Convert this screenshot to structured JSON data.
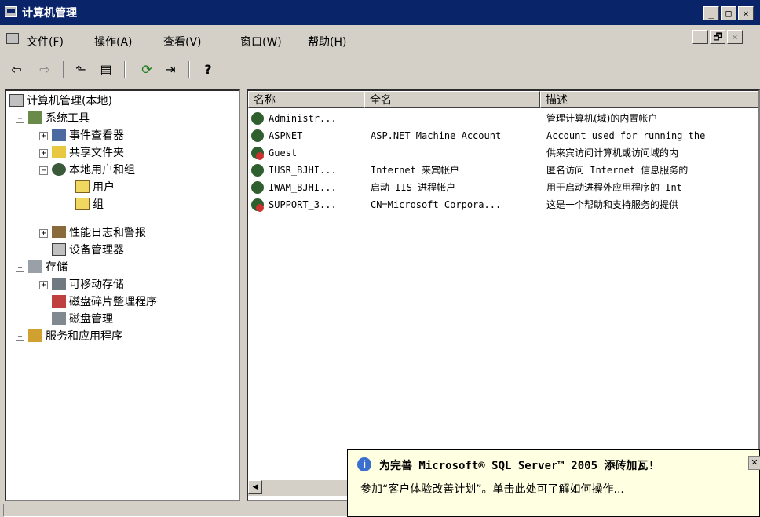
{
  "window": {
    "title": "计算机管理"
  },
  "caption_buttons": [
    "_",
    "□",
    "✕"
  ],
  "mdi_buttons": [
    "_",
    "🗗",
    "✕"
  ],
  "menu": [
    {
      "label": "文件(F)"
    },
    {
      "label": "操作(A)"
    },
    {
      "label": "查看(V)"
    },
    {
      "label": "窗口(W)"
    },
    {
      "label": "帮助(H)"
    }
  ],
  "toolbar": {
    "back": "⇦",
    "forward": "⇨",
    "up": "⬑",
    "console_tree": "▤",
    "refresh": "⟳",
    "export": "⇥",
    "help": "?"
  },
  "tree": {
    "root": "计算机管理(本地)",
    "system_tools": "系统工具",
    "event_viewer": "事件查看器",
    "shared_folders": "共享文件夹",
    "local_users": "本地用户和组",
    "users": "用户",
    "groups": "组",
    "perf_logs": "性能日志和警报",
    "device_manager": "设备管理器",
    "storage": "存储",
    "removable": "可移动存储",
    "defrag": "磁盘碎片整理程序",
    "disk_mgmt": "磁盘管理",
    "services_apps": "服务和应用程序"
  },
  "list": {
    "columns": [
      "名称",
      "全名",
      "描述"
    ],
    "rows": [
      {
        "name": "Administr...",
        "fullname": "",
        "description": "管理计算机(域)的内置帐户",
        "disabled": false
      },
      {
        "name": "ASPNET",
        "fullname": "ASP.NET Machine Account",
        "description": "Account used for running the",
        "disabled": false
      },
      {
        "name": "Guest",
        "fullname": "",
        "description": "供来宾访问计算机或访问域的内",
        "disabled": true
      },
      {
        "name": "IUSR_BJHI...",
        "fullname": "Internet 来宾帐户",
        "description": "匿名访问 Internet 信息服务的",
        "disabled": false
      },
      {
        "name": "IWAM_BJHI...",
        "fullname": "启动 IIS 进程帐户",
        "description": "用于启动进程外应用程序的 Int",
        "disabled": false
      },
      {
        "name": "SUPPORT_3...",
        "fullname": "CN=Microsoft Corpora...",
        "description": "这是一个帮助和支持服务的提供",
        "disabled": true
      }
    ]
  },
  "balloon": {
    "icon": "i",
    "title": "为完善 Microsoft® SQL Server™ 2005 添砖加瓦!",
    "body": "参加“客户体验改善计划”。单击此处可了解如何操作...",
    "close": "✕"
  },
  "scrollbar": {
    "left_arrow": "◀"
  }
}
